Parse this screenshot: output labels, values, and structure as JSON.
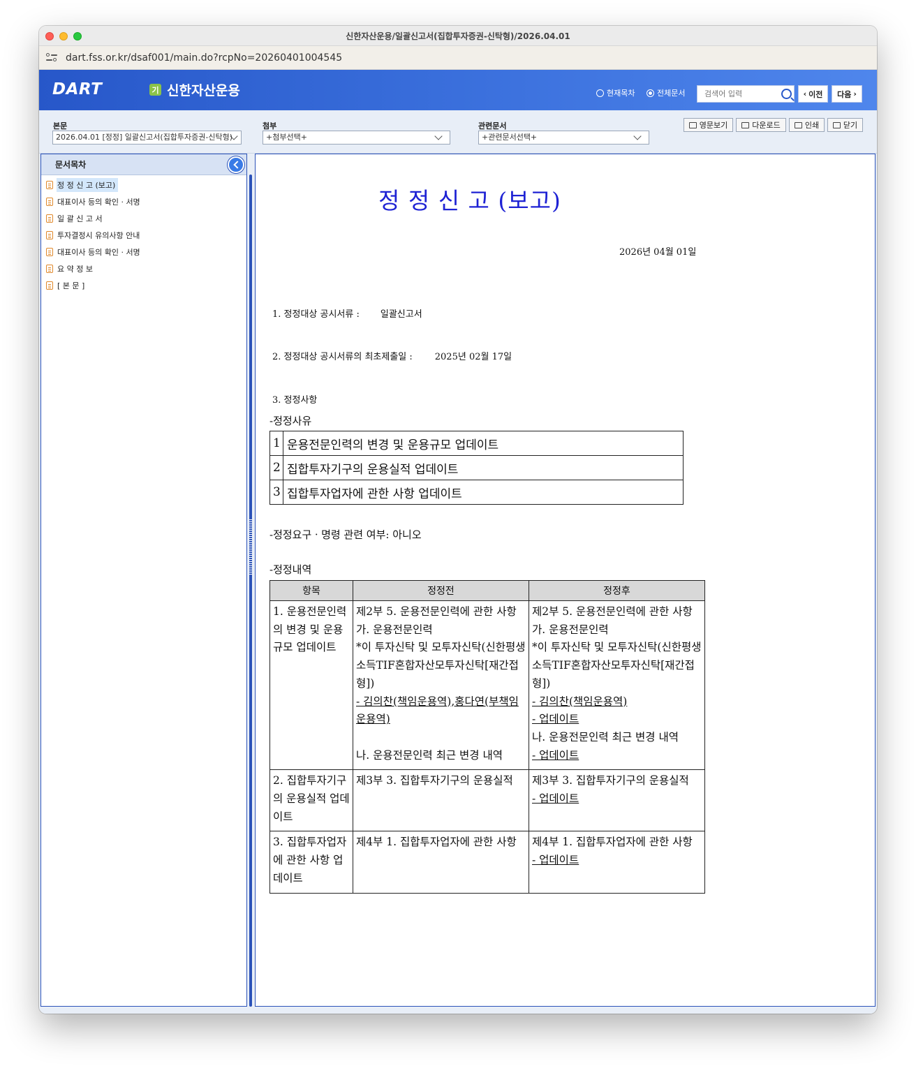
{
  "window": {
    "title": "신한자산운용/일괄신고서(집합투자증권-신탁형)/2026.04.01"
  },
  "url": "dart.fss.or.kr/dsaf001/main.do?rcpNo=20260401004545",
  "header": {
    "logo": "DART",
    "company_badge": "기",
    "company_name": "신한자산운용",
    "radio_current": "현재목차",
    "radio_all": "전체문서",
    "search_placeholder": "검색어 입력",
    "prev_label": "이전",
    "next_label": "다음"
  },
  "toolbar": {
    "main_label": "본문",
    "main_value": "2026.04.01 [정정] 일괄신고서(집합투자증권-신탁형)",
    "attach_label": "첨부",
    "attach_value": "+첨부선택+",
    "related_label": "관련문서",
    "related_value": "+관련문서선택+",
    "english_view": "영문보기",
    "download": "다운로드",
    "print": "인쇄",
    "close": "닫기"
  },
  "toc": {
    "title": "문서목차",
    "items": [
      {
        "label": "정 정 신 고 (보고)"
      },
      {
        "label": "대표이사 등의 확인 · 서명"
      },
      {
        "label": "일 괄 신 고 서"
      },
      {
        "label": "투자결정시 유의사항 안내"
      },
      {
        "label": "대표이사 등의 확인 · 서명"
      },
      {
        "label": "요 약 정 보"
      },
      {
        "label": "[ 본 문 ]"
      }
    ]
  },
  "document": {
    "title": "정 정 신 고 (보고)",
    "date": "2026년 04월 01일",
    "item1_label": "1. 정정대상 공시서류 :",
    "item1_value": "일괄신고서",
    "item2_label": "2. 정정대상 공시서류의 최초제출일 :",
    "item2_value": "2025년 02월 17일",
    "item3_label": "3. 정정사항",
    "reason_title": "-정정사유",
    "reasons": [
      {
        "num": "1",
        "text": "운용전문인력의 변경 및 운용규모 업데이트"
      },
      {
        "num": "2",
        "text": "집합투자기구의 운용실적 업데이트"
      },
      {
        "num": "3",
        "text": "집합투자업자에 관한 사항 업데이트"
      }
    ],
    "order_line": "-정정요구ㆍ명령 관련 여부: 아니오",
    "detail_title": "-정정내역",
    "detail_headers": [
      "항목",
      "정정전",
      "정정후"
    ],
    "rows": [
      {
        "item": "1. 운용전문인력의 변경 및 운용규모 업데이트",
        "before": {
          "l1": "제2부 5. 운용전문인력에 관한 사항",
          "l2": "가. 운용전문인력",
          "l3": "*이 투자신탁 및 모투자신탁(신한평생소득TIF혼합자산모투자신탁[재간접형])",
          "l4": "- 김의찬(책임운용역),홍다연(부책임운용역)",
          "l5": "나. 운용전문인력 최근 변경 내역"
        },
        "after": {
          "l1": "제2부 5. 운용전문인력에 관한 사항",
          "l2": "가. 운용전문인력",
          "l3": "*이 투자신탁 및 모투자신탁(신한평생소득TIF혼합자산모투자신탁[재간접형])",
          "l4": "- 김의찬(책임운용역)",
          "l5": "- 업데이트",
          "l6": "나. 운용전문인력 최근 변경 내역",
          "l7": "- 업데이트"
        }
      },
      {
        "item": "2. 집합투자기구의 운용실적 업데이트",
        "before": {
          "l1": "제3부 3. 집합투자기구의 운용실적"
        },
        "after": {
          "l1": "제3부 3. 집합투자기구의 운용실적",
          "l2": "- 업데이트"
        }
      },
      {
        "item": "3. 집합투자업자에 관한 사항 업데이트",
        "before": {
          "l1": "제4부 1. 집합투자업자에 관한 사항"
        },
        "after": {
          "l1": "제4부 1. 집합투자업자에 관한 사항",
          "l2": "- 업데이트"
        }
      }
    ]
  }
}
